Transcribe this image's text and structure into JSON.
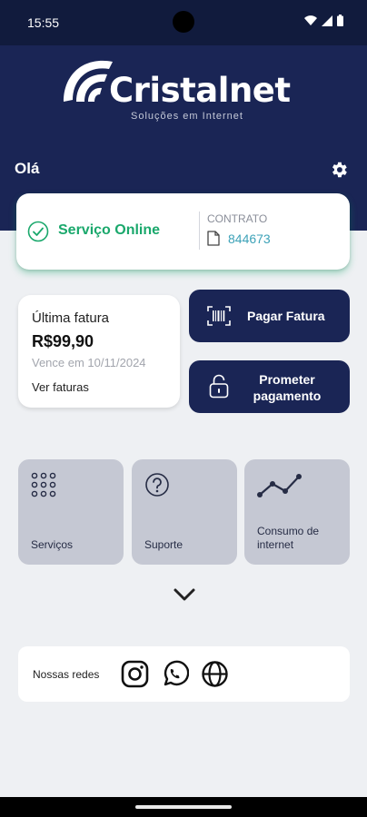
{
  "status_bar": {
    "time": "15:55"
  },
  "brand": {
    "name": "Cristalnet",
    "tagline": "Soluções em Internet"
  },
  "header": {
    "greeting": "Olá"
  },
  "service": {
    "status": "Serviço Online",
    "contract_label": "CONTRATO",
    "contract_number": "844673"
  },
  "invoice": {
    "title": "Última fatura",
    "amount": "R$99,90",
    "due": "Vence em 10/11/2024",
    "link": "Ver faturas"
  },
  "actions": {
    "pay_label": "Pagar Fatura",
    "promise_line1": "Prometer",
    "promise_line2": "pagamento"
  },
  "tiles": [
    {
      "label": "Serviços",
      "icon": "grid-icon"
    },
    {
      "label": "Suporte",
      "icon": "help-icon"
    },
    {
      "label_line1": "Consumo de",
      "label_line2": "internet",
      "icon": "chart-line-icon"
    }
  ],
  "social": {
    "label": "Nossas redes",
    "icons": [
      "instagram-icon",
      "whatsapp-icon",
      "globe-icon"
    ]
  },
  "colors": {
    "navy": "#1a2555",
    "success": "#1aa86c",
    "link": "#3da2b8",
    "tile": "#c5c8d3"
  }
}
